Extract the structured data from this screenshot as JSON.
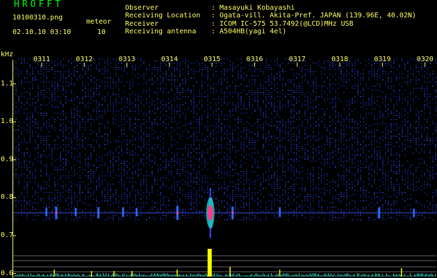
{
  "header": {
    "title": "HROFFT",
    "filename": "10100310.png",
    "datetime": "02.10.10 03:10",
    "meteor_label": "meteor",
    "meteor_count": "10",
    "observer_label": "Observer",
    "observer_value": ": Masayuki Kobayashi",
    "location_label": "Receiving Location",
    "location_value": ": Ogata-vill. Akita-Pref. JAPAN (139.96E, 40.02N)",
    "receiver_label": "Receiver",
    "receiver_value": ": ICOM IC-575 53.7492(@LCD)MHz USB",
    "antenna_label": "Receiving antenna",
    "antenna_value": ": A504HB(yagi 4el)"
  },
  "colors": {
    "title": "#00ff00",
    "labels": "#ffff66",
    "background": "#000000",
    "noise": "#101a5a",
    "signal": "#ff3a8c",
    "spectrum": "#40e0d0",
    "peak": "#ffff00"
  },
  "chart_data": {
    "type": "heatmap",
    "ylabel": "kHz",
    "y_ticks": [
      "1.1",
      "1.0",
      "0.9",
      "0.8",
      "0.7",
      "0.6"
    ],
    "ylim": [
      0.57,
      1.17
    ],
    "x_ticks": [
      "0311",
      "0312",
      "0313",
      "0314",
      "0315",
      "0316",
      "0317",
      "0318",
      "0319",
      "0320"
    ],
    "carrier_freq_khz": 0.76,
    "meteor_events": [
      {
        "minute": 3.2,
        "freq": 0.762,
        "strength": 0.2
      },
      {
        "minute": 3.63,
        "freq": 0.76,
        "strength": 0.35
      },
      {
        "minute": 4.5,
        "freq": 0.762,
        "strength": 0.2
      },
      {
        "minute": 5.5,
        "freq": 0.76,
        "strength": 0.3
      },
      {
        "minute": 6.6,
        "freq": 0.762,
        "strength": 0.25
      },
      {
        "minute": 7.2,
        "freq": 0.762,
        "strength": 0.2
      },
      {
        "minute": 9.0,
        "freq": 0.76,
        "strength": 0.4
      },
      {
        "minute": 10.45,
        "freq": 0.76,
        "strength": 1.0
      },
      {
        "minute": 11.45,
        "freq": 0.76,
        "strength": 0.35
      },
      {
        "minute": 13.55,
        "freq": 0.762,
        "strength": 0.25
      },
      {
        "minute": 17.95,
        "freq": 0.76,
        "strength": 0.3
      },
      {
        "minute": 19.5,
        "freq": 0.76,
        "strength": 0.2
      }
    ],
    "spectrum_peaks": [
      {
        "minute": 3.55,
        "level": 0.25
      },
      {
        "minute": 5.2,
        "level": 0.2
      },
      {
        "minute": 6.2,
        "level": 0.2
      },
      {
        "minute": 7.0,
        "level": 0.2
      },
      {
        "minute": 9.0,
        "level": 0.25
      },
      {
        "minute": 10.45,
        "level": 1.0
      },
      {
        "minute": 11.35,
        "level": 0.35
      },
      {
        "minute": 13.55,
        "level": 0.25
      },
      {
        "minute": 18.95,
        "level": 0.3
      }
    ]
  }
}
